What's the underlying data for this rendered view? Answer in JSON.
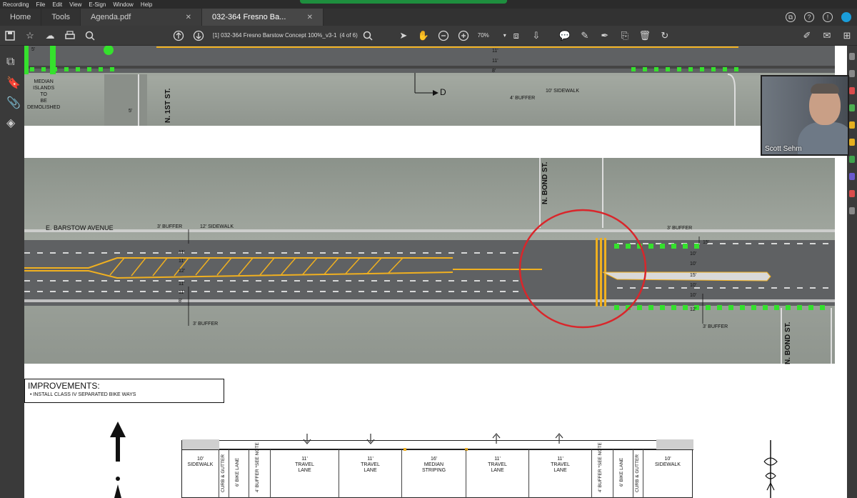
{
  "menubar": {
    "recording": "Recording",
    "items": [
      "File",
      "Edit",
      "View",
      "E-Sign",
      "Window",
      "Help"
    ]
  },
  "tabs": {
    "home": "Home",
    "tools": "Tools",
    "doc1": "Agenda.pdf",
    "doc2": "032-364 Fresno Ba..."
  },
  "toolbar": {
    "docname": "[1] 032-364 Fresno Barstow Concept 100%_v3-1",
    "pageinfo": "(4 of 6)",
    "zoom": "70%"
  },
  "plan": {
    "street_main": "E. BARSTOW AVENUE",
    "street_1st": "N. 1ST ST.",
    "street_bond": "N. BOND ST.",
    "street_bond2": "N. BOND ST.",
    "median_note": "MEDIAN\nISLANDS\nTO\nBE\nDEMOLISHED",
    "buffer3_top": "3' BUFFER",
    "sidewalk12": "12' SIDEWALK",
    "buffer3_bottom": "3' BUFFER",
    "buffer3_right_top": "3' BUFFER",
    "buffer3_right_bottom": "3' BUFFER",
    "buffer4": "4' BUFFER",
    "sidewalk10": "10' SIDEWALK",
    "section_d": "D",
    "dims_left": [
      "11'",
      "11'",
      "12'",
      "11'",
      "11'",
      "8'"
    ],
    "dims_right": [
      "15'",
      "10'",
      "10'",
      "15'",
      "10'",
      "10'",
      "12'"
    ],
    "dims_top": [
      "11'",
      "11'",
      "8'"
    ],
    "dim_5a": "5'",
    "dim_5b": "5'"
  },
  "improvements": {
    "title": "IMPROVEMENTS:",
    "item": "INSTALL CLASS IV SEPARATED BIKE WAYS"
  },
  "cross_section": {
    "sidewalk_left": "10'\nSIDEWALK",
    "curb_left": "CURB & GUTTER",
    "bike_left": "6' BIKE LANE",
    "buffer_left": "4' BUFFER *SEE NOTE",
    "travel1": "11'\nTRAVEL\nLANE",
    "travel2": "11'\nTRAVEL\nLANE",
    "median": "16'\nMEDIAN\nSTRIPING",
    "travel3": "11'\nTRAVEL\nLANE",
    "travel4": "11'\nTRAVEL\nLANE",
    "buffer_right": "4' BUFFER *SEE NOTE",
    "bike_right": "6' BIKE LANE",
    "curb_right": "CURB & GUTTER",
    "sidewalk_right": "10'\nSIDEWALK"
  },
  "video": {
    "participant": "Scott Sehm"
  },
  "colors": {
    "accent": "#1a9dd9",
    "bike_lane_green": "#35e12d",
    "median_yellow": "#f0b020",
    "markup_red": "#d9262b"
  }
}
